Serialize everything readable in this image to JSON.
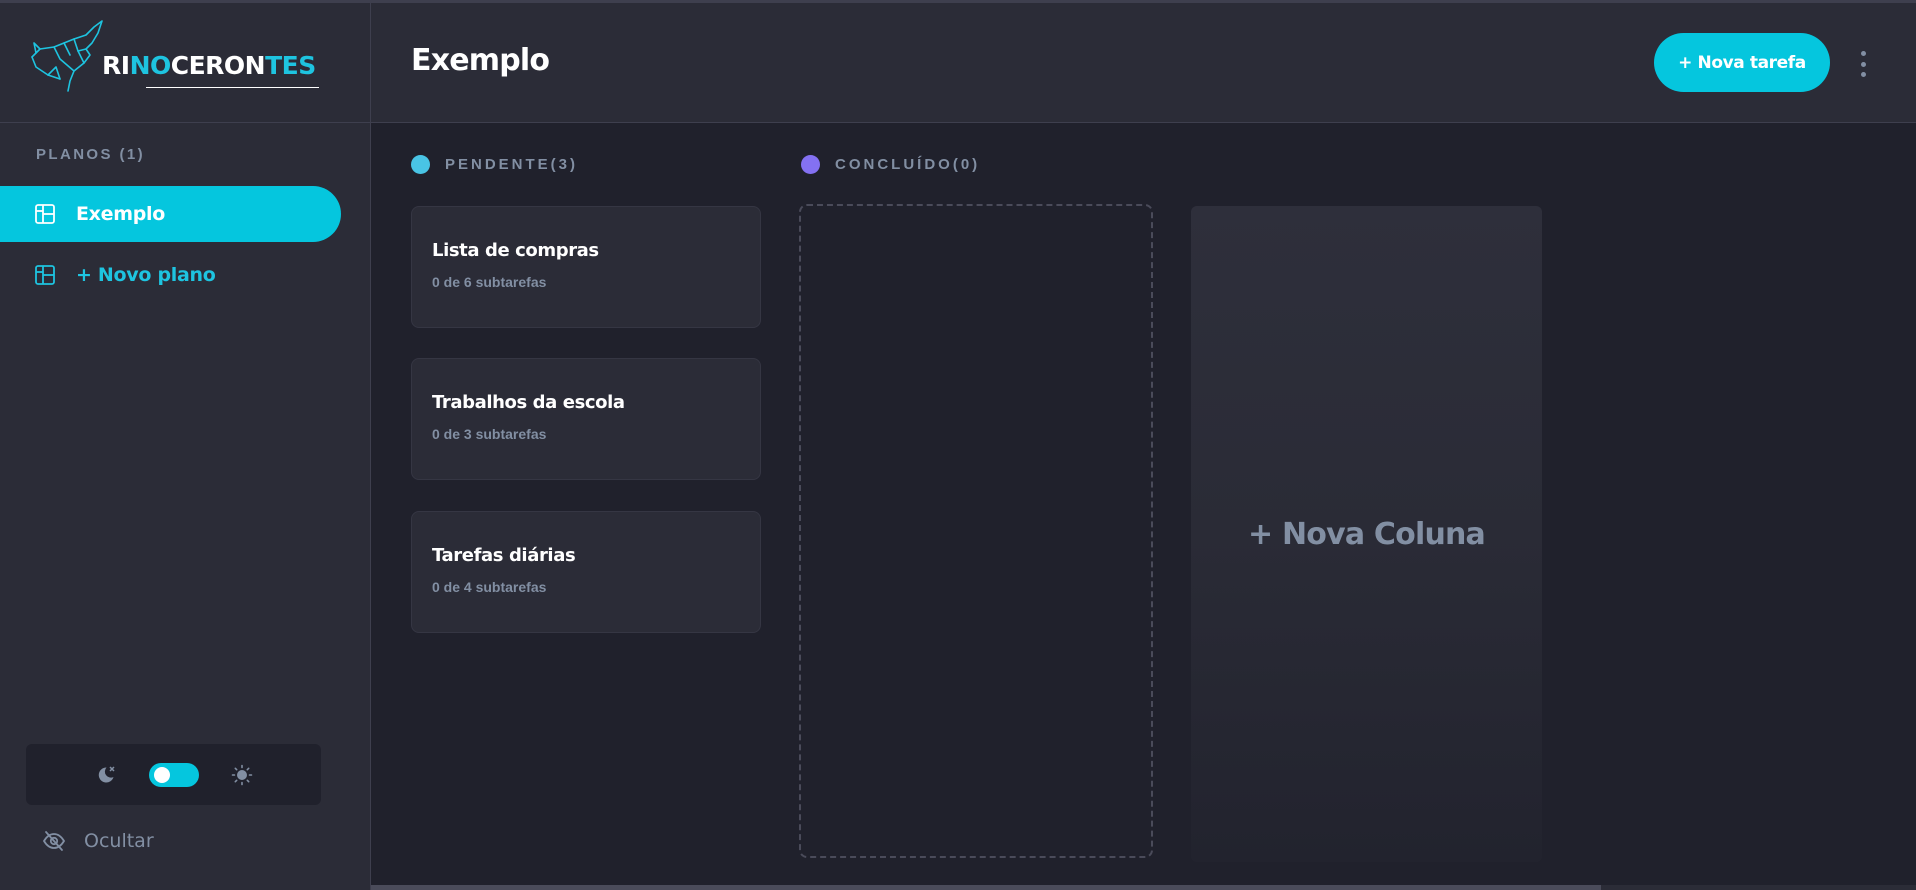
{
  "colors": {
    "accent": "#05c6de",
    "background": "#20212c",
    "panel": "#2b2c37",
    "muted": "#828fa3",
    "pending_dot": "#49c4e5",
    "done_dot": "#8471f2"
  },
  "brand": {
    "logo_white_1": "RI",
    "logo_cyan_1": "NO",
    "logo_white_2": "CERON",
    "logo_cyan_2": "TES"
  },
  "sidebar": {
    "heading": "PLANOS (1)",
    "boards": [
      {
        "label": "Exemplo",
        "icon": "board-icon",
        "active": true
      }
    ],
    "new_board_label": "+ Novo plano",
    "theme": {
      "dark_icon": "moon-icon",
      "light_icon": "sun-icon",
      "toggle_state": "dark"
    },
    "hide_label": "Ocultar",
    "hide_icon": "eye-slash-icon"
  },
  "header": {
    "title": "Exemplo",
    "add_task_label": "+ Nova tarefa",
    "menu_icon": "vertical-ellipsis-icon"
  },
  "columns": [
    {
      "title": "PENDENTE(3)",
      "tasks": [
        {
          "title": "Lista de compras",
          "subtitle": "0 de 6 subtarefas"
        },
        {
          "title": "Trabalhos da escola",
          "subtitle": "0 de 3 subtarefas"
        },
        {
          "title": "Tarefas diárias",
          "subtitle": "0 de 4 subtarefas"
        }
      ]
    },
    {
      "title": "CONCLUÍDO(0)",
      "tasks": []
    }
  ],
  "new_column_label": "+ Nova Coluna"
}
